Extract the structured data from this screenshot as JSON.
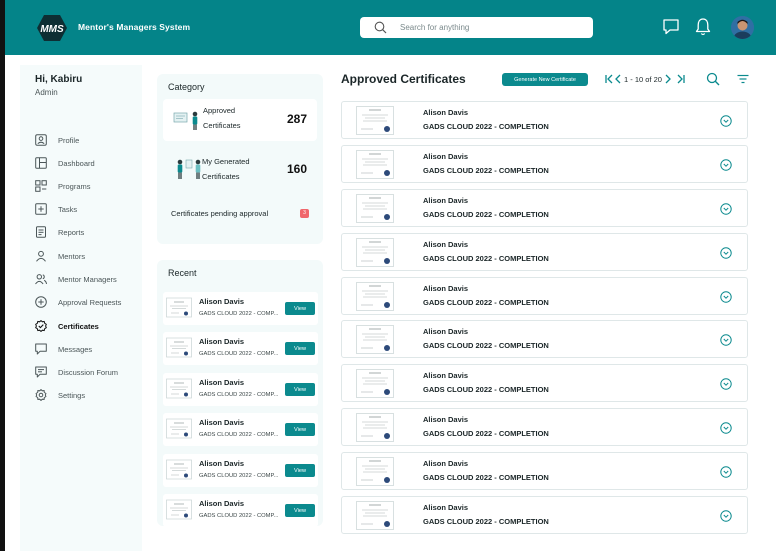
{
  "header": {
    "logo_text": "MMS",
    "app_title": "Mentor's Managers System",
    "search_placeholder": "Search for anything",
    "icons": [
      "message-icon",
      "bell-icon"
    ],
    "accent": "#048489"
  },
  "user": {
    "greeting": "Hi, Kabiru",
    "role": "Admin"
  },
  "sidebar": {
    "items": [
      {
        "label": "Profile",
        "icon": "profile-icon"
      },
      {
        "label": "Dashboard",
        "icon": "dashboard-icon"
      },
      {
        "label": "Programs",
        "icon": "programs-icon"
      },
      {
        "label": "Tasks",
        "icon": "tasks-icon"
      },
      {
        "label": "Reports",
        "icon": "reports-icon"
      },
      {
        "label": "Mentors",
        "icon": "mentor-icon"
      },
      {
        "label": "Mentor Managers",
        "icon": "mentor-managers-icon"
      },
      {
        "label": "Approval Requests",
        "icon": "plus-circle-icon"
      },
      {
        "label": "Certificates",
        "icon": "certificate-icon",
        "active": true
      },
      {
        "label": "Messages",
        "icon": "message-icon"
      },
      {
        "label": "Discussion Forum",
        "icon": "forum-icon"
      },
      {
        "label": "Settings",
        "icon": "gear-icon"
      }
    ]
  },
  "category": {
    "title": "Category",
    "approved": {
      "line1": "Approved",
      "line2": "Certificates",
      "count": "287"
    },
    "generated": {
      "line1": "My Generated",
      "line2": "Certificates",
      "count": "160"
    },
    "pending": {
      "label": "Certificates pending approval",
      "count": "3"
    }
  },
  "recent": {
    "title": "Recent",
    "button_label": "View",
    "items": [
      {
        "name": "Alison Davis",
        "sub": "GADS CLOUD 2022 - COMP..."
      },
      {
        "name": "Alison Davis",
        "sub": "GADS CLOUD 2022 - COMP..."
      },
      {
        "name": "Alison Davis",
        "sub": "GADS CLOUD 2022 - COMP..."
      },
      {
        "name": "Alison Davis",
        "sub": "GADS CLOUD 2022 - COMP..."
      },
      {
        "name": "Alison Davis",
        "sub": "GADS CLOUD 2022 - COMP..."
      },
      {
        "name": "Alison Davis",
        "sub": "GADS CLOUD 2022 - COMP..."
      }
    ]
  },
  "main": {
    "title": "Approved Certificates",
    "generate_button": "Generate New Certificate",
    "pagination": "1 - 10 of 20",
    "items": [
      {
        "name": "Alison Davis",
        "sub": "GADS CLOUD 2022 - COMPLETION"
      },
      {
        "name": "Alison Davis",
        "sub": "GADS CLOUD 2022 - COMPLETION"
      },
      {
        "name": "Alison Davis",
        "sub": "GADS CLOUD 2022 - COMPLETION"
      },
      {
        "name": "Alison Davis",
        "sub": "GADS CLOUD 2022 - COMPLETION"
      },
      {
        "name": "Alison Davis",
        "sub": "GADS CLOUD 2022 - COMPLETION"
      },
      {
        "name": "Alison Davis",
        "sub": "GADS CLOUD 2022 - COMPLETION"
      },
      {
        "name": "Alison Davis",
        "sub": "GADS CLOUD 2022 - COMPLETION"
      },
      {
        "name": "Alison Davis",
        "sub": "GADS CLOUD 2022 - COMPLETION"
      },
      {
        "name": "Alison Davis",
        "sub": "GADS CLOUD 2022 - COMPLETION"
      },
      {
        "name": "Alison Davis",
        "sub": "GADS CLOUD 2022 - COMPLETION"
      }
    ]
  }
}
